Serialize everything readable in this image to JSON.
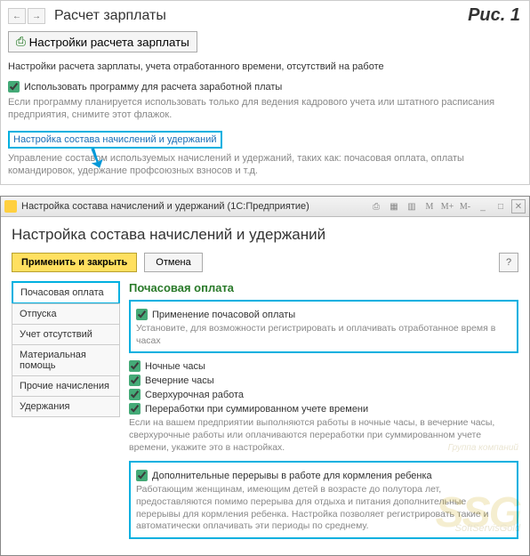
{
  "figure_label": "Рис. 1",
  "page1": {
    "title": "Расчет зарплаты",
    "print_btn": "Настройки расчета зарплаты",
    "intro": "Настройки расчета зарплаты, учета отработанного времени, отсутствий на работе",
    "use_program_label": "Использовать программу для расчета заработной платы",
    "use_program_hint": "Если программу планируется использовать только для ведения кадрового учета или штатного расписания предприятия, снимите этот флажок.",
    "config_link": "Настройка состава начислений и удержаний",
    "config_desc": "Управление составом используемых начислений и удержаний, таких как: почасовая оплата, оплаты командировок, удержание профсоюзных взносов и т.д."
  },
  "window2": {
    "titlebar": "Настройка состава начислений и удержаний  (1С:Предприятие)",
    "heading": "Настройка состава начислений и удержаний",
    "apply_btn": "Применить и закрыть",
    "cancel_btn": "Отмена",
    "help_btn": "?",
    "tabs": [
      {
        "label": "Почасовая оплата"
      },
      {
        "label": "Отпуска"
      },
      {
        "label": "Учет отсутствий"
      },
      {
        "label": "Материальная помощь"
      },
      {
        "label": "Прочие начисления"
      },
      {
        "label": "Удержания"
      }
    ],
    "panel": {
      "title": "Почасовая оплата",
      "opt1": {
        "label": "Применение почасовой оплаты",
        "hint": "Установите, для возможности регистрировать и оплачивать отработанное время в часах"
      },
      "opt2": "Ночные часы",
      "opt3": "Вечерние часы",
      "opt4": "Сверхурочная работа",
      "opt5": "Переработки при суммированном учете времени",
      "general_hint": "Если на вашем предприятии выполняются работы в ночные часы, в вечерние часы, сверхурочные работы или оплачиваются переработки при суммированном учете времени, укажите это в настройках.",
      "opt6": {
        "label": "Дополнительные перерывы в работе для кормления ребенка",
        "hint": "Работающим женщинам, имеющим детей в возрасте до полутора лет, предоставляются помимо перерыва для отдыха и питания дополнительные перерывы для кормления ребенка. Настройка позволяет регистрировать такие и автоматически оплачивать эти периоды по среднему."
      }
    }
  },
  "watermark": {
    "logo": "SSG",
    "line1": "Группа компаний",
    "line2": "SoftServisGold"
  },
  "toolbar_symbols": {
    "m": "M",
    "mplus": "M+",
    "mminus": "M-",
    "min": "_",
    "max": "□",
    "close": "✕"
  }
}
